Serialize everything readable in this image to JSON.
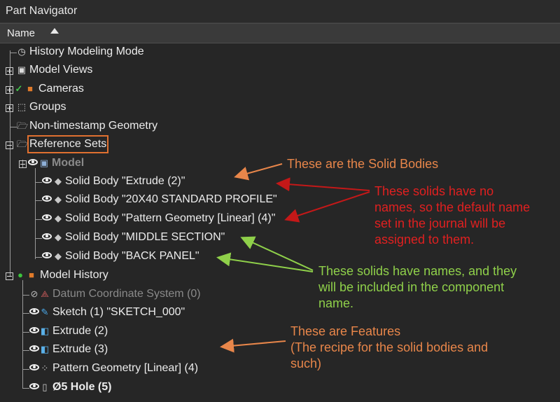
{
  "panel": {
    "title": "Part Navigator"
  },
  "header": {
    "column_name": "Name"
  },
  "tree": {
    "history_mode": "History Modeling Mode",
    "model_views": "Model Views",
    "cameras": "Cameras",
    "groups": "Groups",
    "non_timestamp": "Non-timestamp Geometry",
    "reference_sets": "Reference Sets",
    "model": "Model",
    "bodies": [
      "Solid Body \"Extrude (2)\"",
      "Solid Body \"20X40 STANDARD PROFILE\"",
      "Solid Body \"Pattern Geometry [Linear] (4)\"",
      "Solid Body \"MIDDLE SECTION\"",
      "Solid Body \"BACK PANEL\""
    ],
    "model_history": "Model History",
    "features": [
      "Datum Coordinate System (0)",
      "Sketch (1) \"SKETCH_000\"",
      "Extrude (2)",
      "Extrude (3)",
      "Pattern Geometry [Linear] (4)",
      "Ø5 Hole (5)"
    ]
  },
  "annotations": {
    "solid_bodies": "These are the Solid Bodies",
    "no_names": [
      "These solids have no",
      "names, so the default name",
      "set in the journal will be",
      "assigned to them."
    ],
    "have_names": [
      "These solids have names, and they",
      "will be included in the component",
      "name."
    ],
    "features": [
      "These are Features",
      "(The recipe for the solid bodies and",
      "such)"
    ]
  },
  "colors": {
    "orange": "#e8864a",
    "red": "#e02020",
    "green": "#8fd04a"
  }
}
